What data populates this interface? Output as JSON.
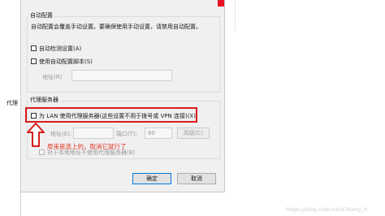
{
  "dialog": {
    "auto_config": {
      "title": "自动配置",
      "description": "自动配置会覆盖手动设置。要确保使用手动设置，请禁用自动配置。",
      "auto_detect_label": "自动检测设置(A)",
      "auto_script_label": "使用自动配置脚本(S)",
      "address_label": "地址(R)",
      "address_value": ""
    },
    "proxy": {
      "title": "代理服务器",
      "use_proxy_label": "为 LAN 使用代理服务器(这些设置不用于拨号或 VPN 连接)(X)",
      "address_label": "地址(E):",
      "address_value": "",
      "port_label": "端口(T):",
      "port_value": "80",
      "advanced_label": "高级(C)",
      "bypass_label": "对于本地地址不使用代理服务器(B)"
    },
    "ok_label": "确定",
    "cancel_label": "取消"
  },
  "annotation": {
    "note": "原来是选上的，取消它就行了",
    "color": "#e0301e"
  },
  "side_label": "代理",
  "watermark": "https://blog.csdn.net/Chiang_H"
}
